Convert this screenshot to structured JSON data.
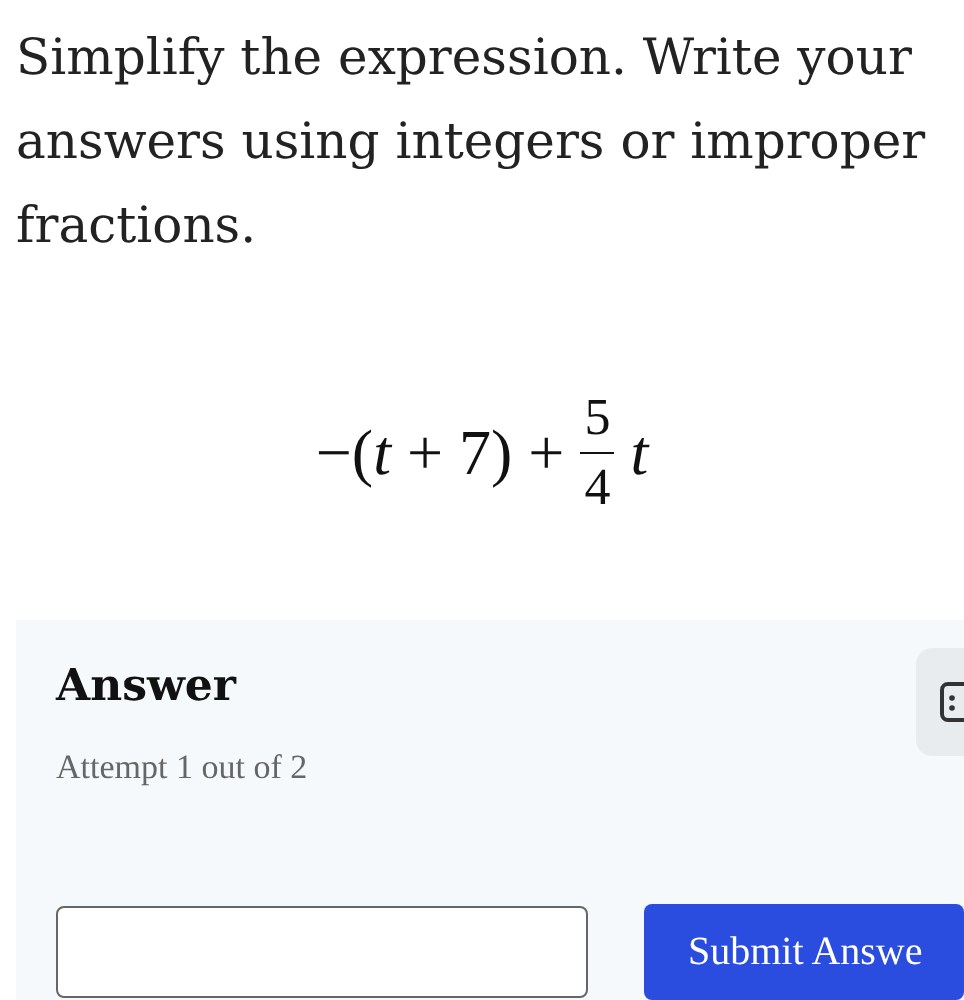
{
  "question": "Simplify the expression. Write your answers using integers or improper fractions.",
  "expression": {
    "before": "−(*t* + 7) +",
    "numerator": "5",
    "denominator": "4",
    "after": "t"
  },
  "answer_panel": {
    "title": "Answer",
    "attempt": "Attempt 1 out of 2",
    "submit_button": "Submit Answe"
  }
}
